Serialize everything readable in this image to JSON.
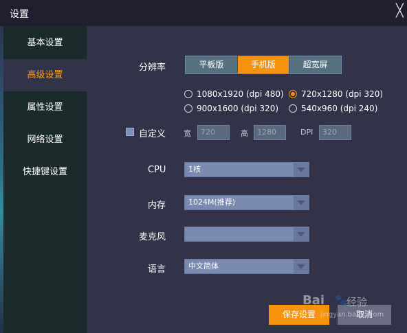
{
  "window": {
    "title": "设置",
    "close_glyph": "╳"
  },
  "sidebar": {
    "items": [
      {
        "label": "基本设置",
        "active": false
      },
      {
        "label": "高级设置",
        "active": true
      },
      {
        "label": "属性设置",
        "active": false
      },
      {
        "label": "网络设置",
        "active": false
      },
      {
        "label": "快捷键设置",
        "active": false
      }
    ]
  },
  "resolution": {
    "label": "分辨率",
    "modes": [
      "平板版",
      "手机版",
      "超宽屏"
    ],
    "selected_mode": "手机版",
    "options": [
      {
        "label": "1080x1920 (dpi 480)",
        "selected": false
      },
      {
        "label": "720x1280 (dpi 320)",
        "selected": true
      },
      {
        "label": "900x1600 (dpi 320)",
        "selected": false
      },
      {
        "label": "540x960 (dpi 240)",
        "selected": false
      }
    ]
  },
  "custom": {
    "label": "自定义",
    "checked": false,
    "width_label": "宽",
    "width_value": "720",
    "height_label": "高",
    "height_value": "1280",
    "dpi_label": "DPI",
    "dpi_value": "320"
  },
  "cpu": {
    "label": "CPU",
    "value": "1核"
  },
  "memory": {
    "label": "内存",
    "value": "1024M(推荐)"
  },
  "microphone": {
    "label": "麦克风",
    "value": ""
  },
  "language": {
    "label": "语言",
    "value": "中文简体"
  },
  "buttons": {
    "save": "保存设置",
    "cancel": "取消"
  },
  "watermark": {
    "logo": "Bai",
    "paw": "🐾",
    "cn": "经验",
    "url": "jingyan.baidu.com"
  },
  "colors": {
    "accent": "#f5930f",
    "sidebar_bg": "#1b2a2b",
    "content_bg": "#323248",
    "titlebar_bg": "#1f1f30"
  }
}
